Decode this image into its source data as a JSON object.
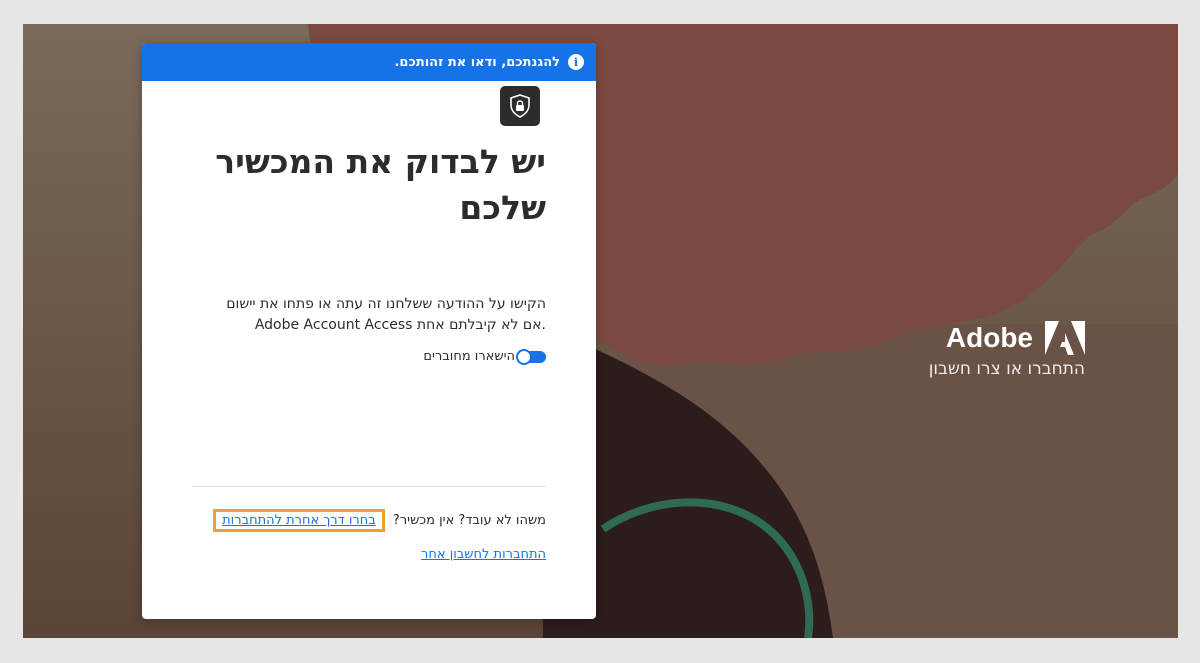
{
  "brand": {
    "name": "Adobe",
    "subtitle": "התחברו או צרו חשבון",
    "logo_icon": "adobe-logo-icon"
  },
  "banner": {
    "icon": "info-icon",
    "text": "להגנתכם, ודאו את זהותכם."
  },
  "card": {
    "icon": "shield-lock-icon",
    "title_line1": "יש לבדוק את המכשיר",
    "title_line2": "שלכם",
    "desc_line1": "הקישו על ההודעה ששלחנו זה עתה או פתחו את יישום",
    "desc_line2": "Adobe Account Access אם לא קיבלתם אחת.",
    "stay_signed_in_label": "הישארו מחוברים",
    "stay_signed_in_on": true,
    "help_text": "משהו לא עובד? אין מכשיר?",
    "other_method_link": "בחרו דרך אחרת להתחברות",
    "switch_account_link": "התחברות לחשבון אחר"
  },
  "colors": {
    "accent": "#1473e6",
    "highlight": "#f0a030",
    "background": "#7a4a42"
  }
}
